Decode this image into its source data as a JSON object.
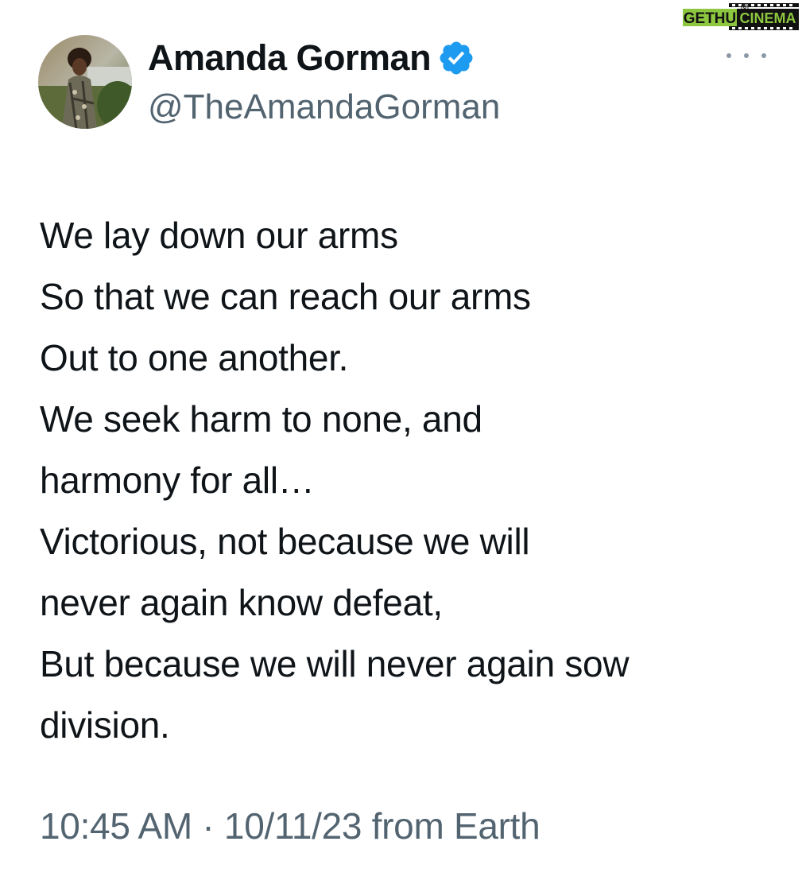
{
  "watermark": {
    "text_left": "GETHU",
    "text_right": "CINEMA",
    "color_bg": "#8dc63f"
  },
  "tweet": {
    "author": {
      "display_name": "Amanda Gorman",
      "handle": "@TheAmandaGorman",
      "verified": true,
      "verified_color": "#1d9bf0",
      "avatar_icon": "avatar-photo"
    },
    "more_icon": "more-horizontal-icon",
    "lines": [
      "We lay down our arms",
      "So that we can reach our arms",
      "Out to one another.",
      "We seek harm to none, and",
      "harmony for all…",
      "Victorious, not because we will",
      "never again know defeat,",
      "But because we will never again sow",
      "division."
    ],
    "meta": "10:45 AM · 10/11/23 from Earth"
  }
}
